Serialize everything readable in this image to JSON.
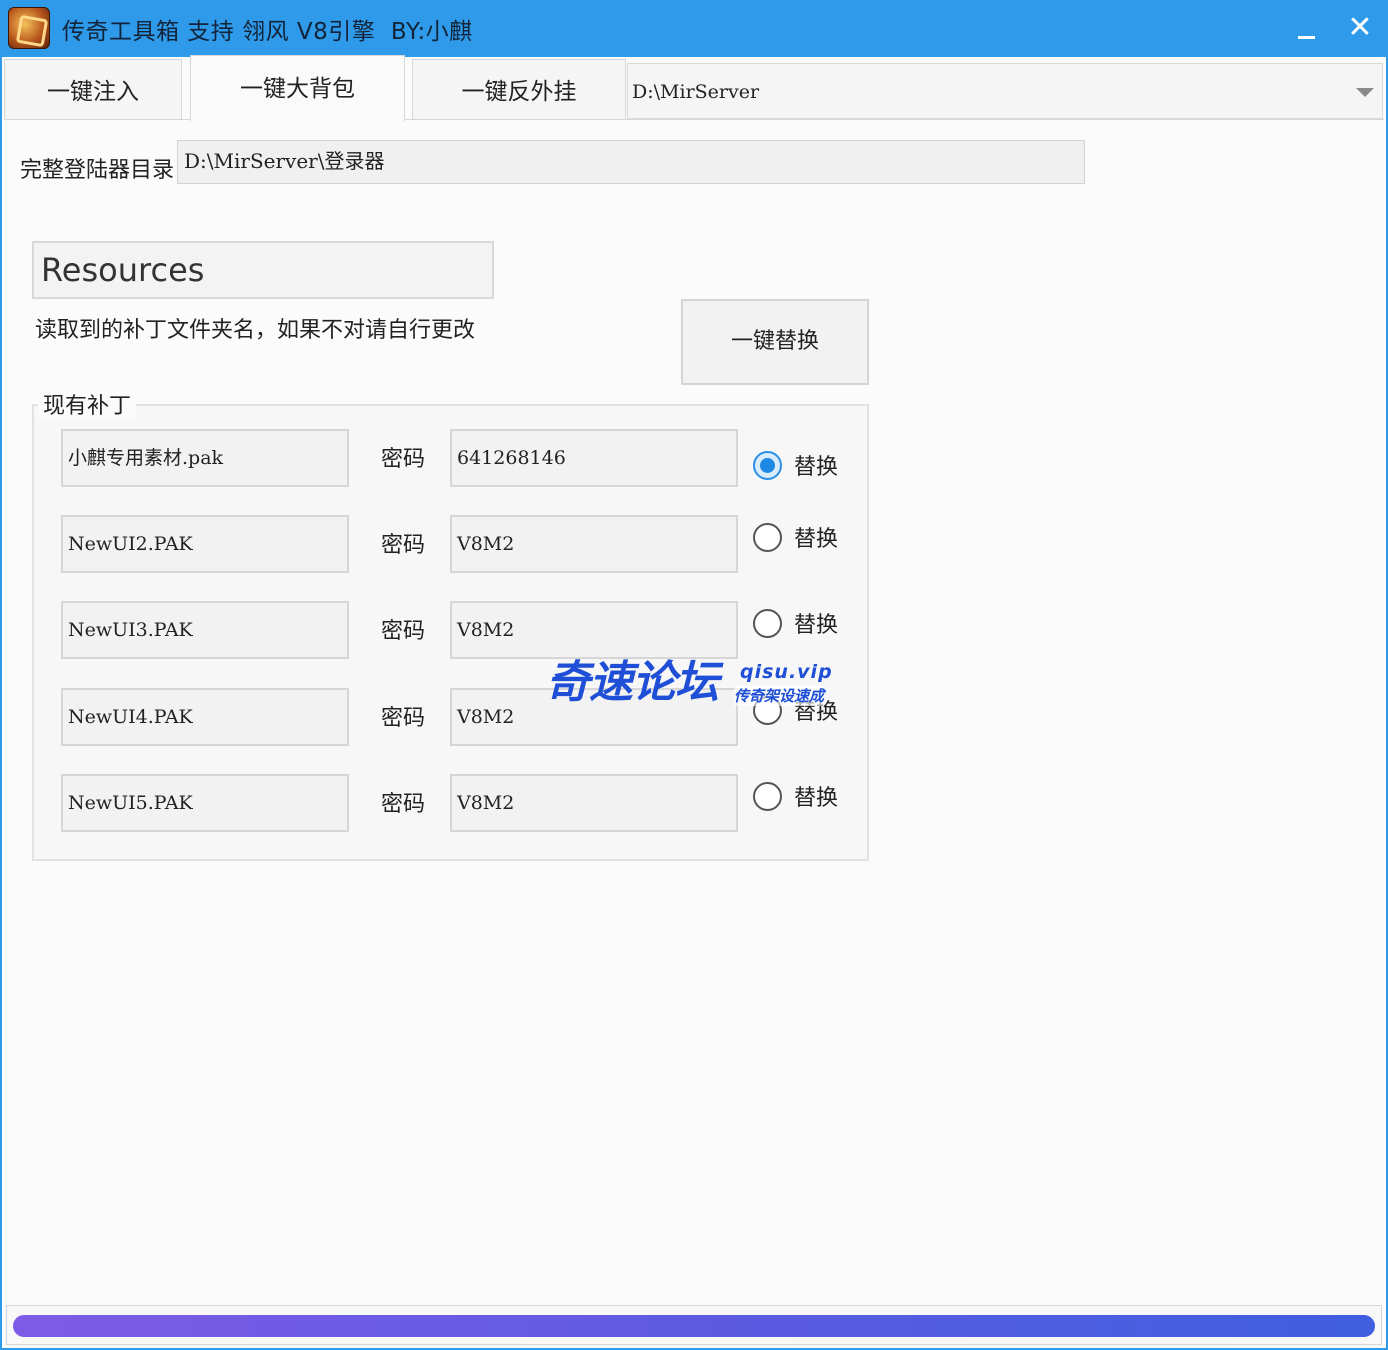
{
  "window": {
    "title": "传奇工具箱 支持 翎风 V8引擎  BY:小麒",
    "minimize_icon": "minimize-icon",
    "close_glyph": "✕"
  },
  "tabs": [
    {
      "label": "一键注入",
      "active": false
    },
    {
      "label": "一键大背包",
      "active": true
    },
    {
      "label": "一键反外挂",
      "active": false
    }
  ],
  "server_path": {
    "value": "D:\\MirServer"
  },
  "launcher_dir": {
    "label": "完整登陆器目录",
    "value": "D:\\MirServer\\登录器"
  },
  "resources": {
    "folder": "Resources",
    "hint": "读取到的补丁文件夹名，如果不对请自行更改"
  },
  "replace_all_label": "一键替换",
  "patches": {
    "group_title": "现有补丁",
    "password_label": "密码",
    "replace_label": "替换",
    "rows": [
      {
        "file": "小麒专用素材.pak",
        "password": "641268146",
        "selected": true
      },
      {
        "file": "NewUI2.PAK",
        "password": "V8M2",
        "selected": false
      },
      {
        "file": "NewUI3.PAK",
        "password": "V8M2",
        "selected": false
      },
      {
        "file": "NewUI4.PAK",
        "password": "V8M2",
        "selected": false
      },
      {
        "file": "NewUI5.PAK",
        "password": "V8M2",
        "selected": false
      }
    ]
  },
  "watermark": {
    "main": "奇速论坛",
    "url": "qisu.vip",
    "sub": "传奇架设速成"
  },
  "progress": {
    "percent": 100
  },
  "colors": {
    "titlebar": "#2f9ae9",
    "accent": "#1e88e5",
    "progress_start": "#7e5be6",
    "progress_end": "#3f5fe0"
  }
}
